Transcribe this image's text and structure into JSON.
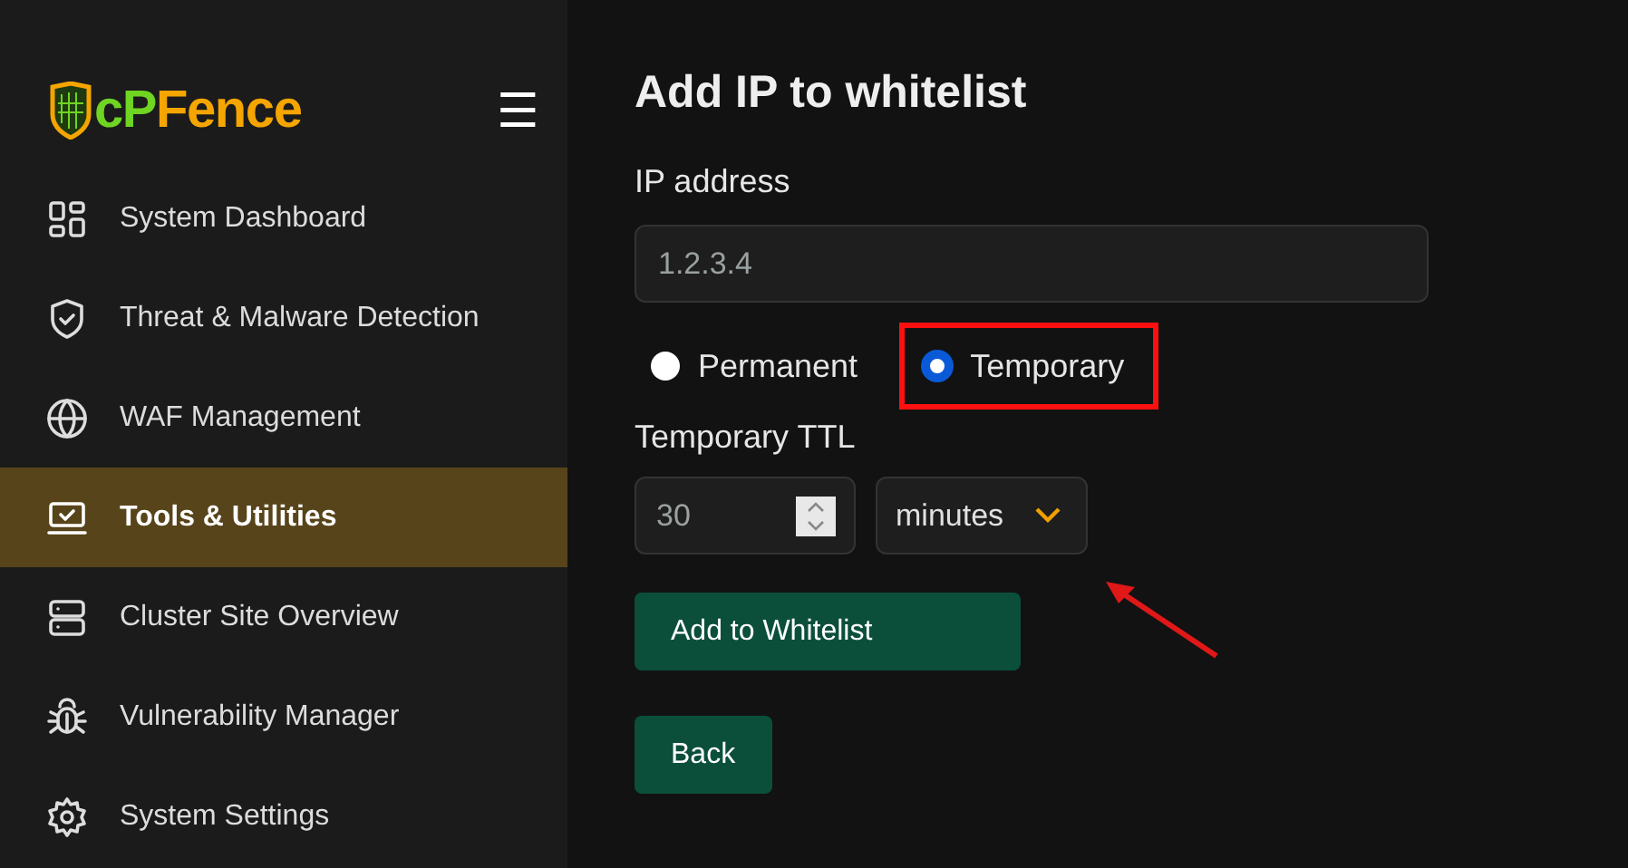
{
  "sidebar": {
    "logo_parts": [
      {
        "text": "cP",
        "color": "#6fd422"
      },
      {
        "text": "Fence",
        "color": "#f5a500"
      }
    ],
    "menu_icon": "☰",
    "items": [
      {
        "label": "System Dashboard",
        "kind": "grid",
        "selected": false
      },
      {
        "label": "Threat & Malware Detection",
        "kind": "shield",
        "selected": false
      },
      {
        "label": "WAF Management",
        "kind": "globe",
        "selected": false
      },
      {
        "label": "Tools & Utilities",
        "kind": "laptop",
        "selected": true
      },
      {
        "label": "Cluster Site Overview",
        "kind": "server",
        "selected": false
      },
      {
        "label": "Vulnerability Manager",
        "kind": "bug",
        "selected": false
      },
      {
        "label": "System Settings",
        "kind": "gear",
        "selected": false
      }
    ]
  },
  "form": {
    "title": "Add IP to whitelist",
    "ip_label": "IP address",
    "ip_value": "1.2.3.4",
    "options": [
      {
        "label": "Permanent",
        "selected": false,
        "highlighted": false
      },
      {
        "label": "Temporary",
        "selected": true,
        "highlighted": true
      }
    ],
    "ttl_label": "Temporary TTL",
    "ttl_value": "30",
    "unit": "minutes",
    "buttons": [
      "Add to Whitelist",
      "Back"
    ]
  },
  "annotations": [
    {
      "kind": "arrow"
    }
  ]
}
